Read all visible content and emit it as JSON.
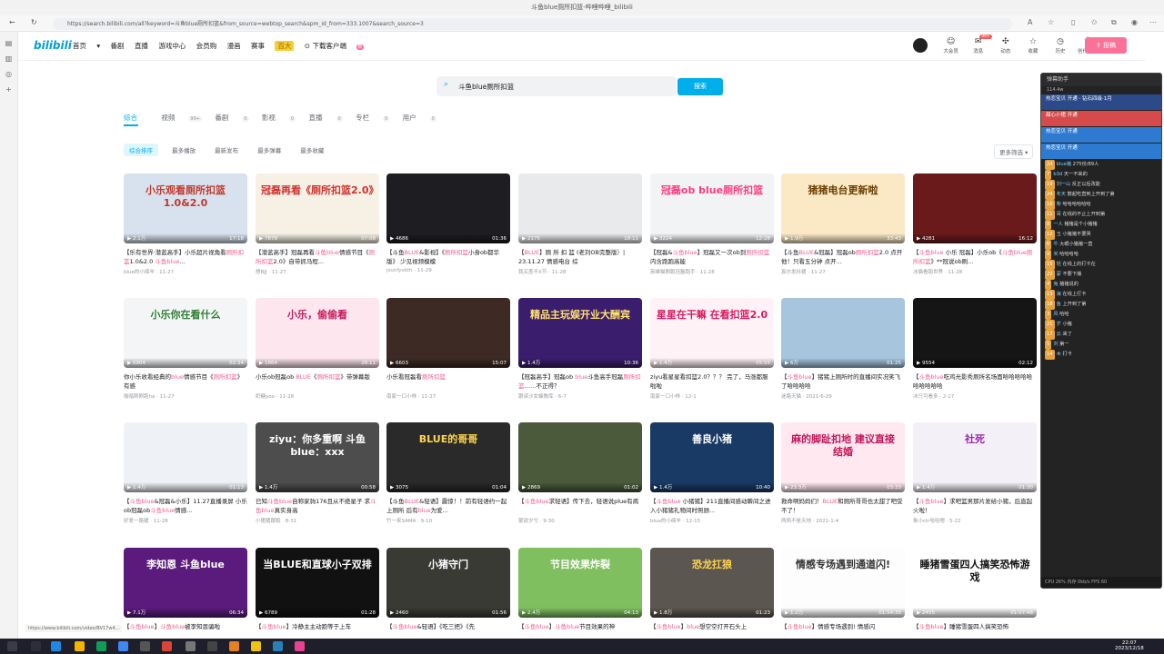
{
  "window": {
    "title": "斗鱼blue厕所扣篮-哔哩哔哩_bilibili"
  },
  "address": {
    "url": "https://search.bilibili.com/all?keyword=斗鱼blue厕所扣篮&from_source=webtop_search&spm_id_from=333.1007&search_source=3"
  },
  "header": {
    "logo": "bilibili",
    "nav": [
      "首页",
      "番剧",
      "直播",
      "游戏中心",
      "会员购",
      "漫画",
      "赛事"
    ],
    "badge": "百大",
    "download": "下载客户端",
    "download_dot": "新",
    "right_items": [
      {
        "icon": "☺",
        "label": "大会员"
      },
      {
        "icon": "✉",
        "label": "消息",
        "badge": "99+"
      },
      {
        "icon": "✣",
        "label": "动态"
      },
      {
        "icon": "☆",
        "label": "收藏"
      },
      {
        "icon": "◷",
        "label": "历史"
      },
      {
        "icon": "♁",
        "label": "创作中心"
      }
    ],
    "upload": "投稿"
  },
  "search": {
    "query": "斗鱼blue厕所扣篮",
    "button": "搜索"
  },
  "tabs": [
    {
      "label": "综合",
      "count": ""
    },
    {
      "label": "视频",
      "count": "99+"
    },
    {
      "label": "番剧",
      "count": "0"
    },
    {
      "label": "影视",
      "count": "0"
    },
    {
      "label": "直播",
      "count": "0"
    },
    {
      "label": "专栏",
      "count": "0"
    },
    {
      "label": "用户",
      "count": "0"
    }
  ],
  "filters": [
    "综合排序",
    "最多播放",
    "最新发布",
    "最多弹幕",
    "最多收藏"
  ],
  "more_filter": "更多筛选",
  "videos": [
    {
      "cap": "小乐观看厕所扣篮1.0&2.0",
      "views": "2.1万",
      "dur": "17:18",
      "title": "【乐有世界·潜蓝高手】小乐超片视角看厕所扣篮1.0&2.0 斗鱼blue...",
      "up": "blue的小绵羊 · 11-27",
      "bg": "#d8e2ee",
      "fg": "#c0392b"
    },
    {
      "cap": "冠磊再看《厕所扣篮2.0》",
      "views": "7878",
      "dur": "07:08",
      "title": "【潜蓝高手】冠磊再看斗鱼blue情感节目《厕所扣篮2.0》自带抓马程...",
      "up": "想BJJ · 11-27",
      "bg": "#f6f1e4",
      "fg": "#d32f2f"
    },
    {
      "cap": "",
      "views": "4686",
      "dur": "01:36",
      "title": "【斗鱼BLUE&影视】《厕所扣篮小身ob都华版》 少见视频模模",
      "up": "jsunfyvkth · 11-29",
      "bg": "#1e1e22",
      "fg": "#fff"
    },
    {
      "cap": "",
      "views": "2175",
      "dur": "18:11",
      "title": "【BLUE】厕 所 扣 篮 (老刘OB完整版）| 23.11.27 情感电台 综",
      "up": "我买差不X节 · 11-28",
      "bg": "#e9eaec",
      "fg": "#333"
    },
    {
      "cap": "冠磊ob blue厕所扣篮",
      "views": "3224",
      "dur": "12:28",
      "title": "【冠磊&斗鱼blue】冠磊又一次ob到厕所扣篮 内含跑跑高能",
      "up": "英雄猫刚跑冠磊跑手 · 11-28",
      "bg": "#f2f3f5",
      "fg": "#ff3b7f"
    },
    {
      "cap": "猪猪电台更新啦",
      "views": "1.9万",
      "dur": "33:43",
      "title": "【斗鱼BLUE&冠磊】冠磊ob厕所扣篮2.0 点开他！只看五分钟 点开...",
      "up": "真尔发抖猪 · 11-27",
      "bg": "#fbe9c6",
      "fg": "#6b3e00"
    },
    {
      "cap": "",
      "views": "4281",
      "dur": "16:12",
      "title": "【斗鱼blue 小乐 冠磊】小乐ob《斗鱼blue厕所扣篮》**冠说ob刷...",
      "up": "冰猫看跑世界 · 11-28",
      "bg": "#6a1a1a",
      "fg": "#fff"
    },
    {
      "cap": "小乐你在看什么",
      "views": "6904",
      "dur": "02:34",
      "title": "你小乐收看经典的blue情感节目《厕所扣篮》有感",
      "up": "咖暗刚刚跑ha · 11-27",
      "bg": "#f4f5f7",
      "fg": "#2e7d32"
    },
    {
      "cap": "小乐，偷偷看",
      "views": "1864",
      "dur": "28:11",
      "title": "小乐ob冠磊ob BLUE《厕所扣篮》带弹幕版",
      "up": "奶糖yoo · 11-28",
      "bg": "#fde6ee",
      "fg": "#c2185b"
    },
    {
      "cap": "",
      "views": "6603",
      "dur": "15:07",
      "title": "小乐看冠磊看厕所扣篮",
      "up": "南家一口小林 · 11-27",
      "bg": "#3d2a24",
      "fg": "#fff"
    },
    {
      "cap": "精品主玩娱开业大酬宾",
      "views": "1.4万",
      "dur": "10:36",
      "title": "【冠磊高手】冠磊ob blue斗鱼高手冠磊厕所扣篮……不正得？",
      "up": "跟读沙女蜂教库 · 6-7",
      "bg": "#3b1d6e",
      "fg": "#ffe16b"
    },
    {
      "cap": "星星在干嘛 在看扣篮2.0",
      "views": "1.4万",
      "dur": "05:55",
      "title": "ziyu看星星看扣篮2.0？？？ 完了，马涨都服啦啦",
      "up": "南家一口小林 · 12-1",
      "bg": "#fff2f6",
      "fg": "#d81b60"
    },
    {
      "cap": "",
      "views": "6万",
      "dur": "01:25",
      "title": "【斗鱼blue】猪猪上厕所时的直播间实况笑飞了哈哈哈哈",
      "up": "迷路天猫 · 2021-6-29",
      "bg": "#a7c6de",
      "fg": "#fff"
    },
    {
      "cap": "",
      "views": "9554",
      "dur": "02:12",
      "title": "【斗鱼blue吃鸡光影秀厕所名场面哈哈哈哈哈哈哈哈哈哈",
      "up": "冰只可看多 · 2-17",
      "bg": "#151515",
      "fg": "#fff"
    },
    {
      "cap": "",
      "views": "1.4万",
      "dur": "01:13",
      "title": "【斗鱼blue&冠磊&小乐】11.27直播录屏 小乐ob冠磊ob斗鱼blue情感...",
      "up": "好爱一路猪 · 11-28",
      "bg": "#eef1f5",
      "fg": "#333"
    },
    {
      "cap": "ziyu：你多重啊 斗鱼blue：xxx",
      "views": "1.4万",
      "dur": "00:58",
      "title": "已知斗鱼blue自称家驹176且从不绝星子 求斗鱼blue真实身高",
      "up": "小猪猪跟跑 · 8-31",
      "bg": "#4d4d4d",
      "fg": "#fff"
    },
    {
      "cap": "BLUE的哥哥",
      "views": "3075",
      "dur": "01:04",
      "title": "【斗鱼BLUE&轻语】震惊！！前有轻语约一起上厕所 后有blue为爱...",
      "up": "竹一来SAMA · 9-10",
      "bg": "#2a2a2a",
      "fg": "#ffd54f"
    },
    {
      "cap": "",
      "views": "2869",
      "dur": "01:02",
      "title": "【斗鱼blue求轻语】传下去，轻语说plue有病",
      "up": "蒙锐夕兮 · 9-30",
      "bg": "#4a5a3a",
      "fg": "#ff5a5a"
    },
    {
      "cap": "善良小猪",
      "views": "1.4万",
      "dur": "10:40",
      "title": "【斗鱼blue 小猪猪】211直播间感动瞬间之进入小猪猪礼物间时照顾...",
      "up": "blue的小绵羊 · 12-15",
      "bg": "#1a3a66",
      "fg": "#fff"
    },
    {
      "cap": "麻的脚趾扣地 建议直接结婚",
      "views": "23.3万",
      "dur": "03:33",
      "title": "救命啊妈妈们！BLUE和厕所哥哥也太甜了吧受不了！",
      "up": "两两不是天地 · 2021-1-4",
      "bg": "#ffe8ef",
      "fg": "#c2185b"
    },
    {
      "cap": "社死",
      "views": "1.4万",
      "dur": "01:30",
      "title": "【斗鱼blue】求吧篮男那片发给小猪，后直起火啦！",
      "up": "象小ctr哈哈嗯 · 5-22",
      "bg": "#f3f0f7",
      "fg": "#9c27b0"
    },
    {
      "cap": "李知恩 斗鱼blue",
      "views": "7.1万",
      "dur": "06:34",
      "title": "【斗鱼blue】斗鱼blue被李知恩骗啦",
      "up": "",
      "bg": "#5a1b7d",
      "fg": "#fff"
    },
    {
      "cap": "当BLUE和直球小子双排",
      "views": "6789",
      "dur": "01:28",
      "title": "【斗鱼blue】冷静主主动跑等于上车",
      "up": "",
      "bg": "#111",
      "fg": "#fff"
    },
    {
      "cap": "小猪守门",
      "views": "2460",
      "dur": "01:56",
      "title": "【斗鱼blue&轻语】《吃三把》《先",
      "up": "",
      "bg": "#3a3a34",
      "fg": "#fff"
    },
    {
      "cap": "节目效果炸裂",
      "views": "2.4万",
      "dur": "04:13",
      "title": "【斗鱼blue】斗鱼blue节目效果的神",
      "up": "",
      "bg": "#7fbf5f",
      "fg": "#fff"
    },
    {
      "cap": "恐龙扛狼",
      "views": "1.8万",
      "dur": "01:23",
      "title": "【斗鱼blue】blue想空空打开石头上",
      "up": "",
      "bg": "#5b5650",
      "fg": "#ffd54f"
    },
    {
      "cap": "情感专场遇到通道闪!",
      "views": "1.2万",
      "dur": "01:54:35",
      "title": "【斗鱼blue】情感专场遇到! 情感闪",
      "up": "",
      "bg": "#fdfdfd",
      "fg": "#333"
    },
    {
      "cap": "睡猪雪蛋四人搞笑恐怖游戏",
      "views": "2455",
      "dur": "01:07:48",
      "title": "【斗鱼blue】睡猪雪蛋四人搞笑恐怖",
      "up": "",
      "bg": "#ffffff",
      "fg": "#111"
    }
  ],
  "danmaku_panel": {
    "title": "弹幕助手",
    "stats": "114.4w",
    "banners": [
      {
        "text": "热恋宝贝 开通 · 钻石四级·1月",
        "color": "#2c4a8a"
      },
      {
        "text": "甜心小猪 开通",
        "color": "#d54a4a"
      },
      {
        "text": "热恋宝贝 开通",
        "color": "#2f7ad1"
      },
      {
        "text": "热恋宝贝 开通",
        "color": "#2f7ad1"
      }
    ],
    "messages": [
      {
        "lv": "24",
        "name": "blue猪",
        "text": "275份/89人"
      },
      {
        "lv": "7",
        "name": "b3d",
        "text": "天一不来的"
      },
      {
        "lv": "19",
        "name": "刘一山",
        "text": "反正以后改能"
      },
      {
        "lv": "24",
        "name": "冬天",
        "text": "鼓起吃直到上开到了第"
      },
      {
        "lv": "10",
        "name": "柴",
        "text": "哈哈哈哈哈哈"
      },
      {
        "lv": "11",
        "name": "哥",
        "text": "在线的不止上开到第"
      },
      {
        "lv": "8",
        "name": "一人",
        "text": "猪猪是个小猪猪"
      },
      {
        "lv": "12",
        "name": "玉",
        "text": "小猪猪不要哭"
      },
      {
        "lv": "6",
        "name": "牛",
        "text": "大眼小猪猪一直"
      },
      {
        "lv": "9",
        "name": "米",
        "text": "哈哈哈哈"
      },
      {
        "lv": "15",
        "name": "轻",
        "text": "在线上的打卡在"
      },
      {
        "lv": "22",
        "name": "蒙",
        "text": "不要下播"
      },
      {
        "lv": "4",
        "name": "兔",
        "text": "猪猪说的"
      },
      {
        "lv": "13",
        "name": "海",
        "text": "在线上打卡"
      },
      {
        "lv": "18",
        "name": "鱼",
        "text": "上开到了第"
      },
      {
        "lv": "3",
        "name": "风",
        "text": "哈哈"
      },
      {
        "lv": "21",
        "name": "岁",
        "text": "小猪"
      },
      {
        "lv": "17",
        "name": "云",
        "text": "来了"
      },
      {
        "lv": "5",
        "name": "刘",
        "text": "第一"
      },
      {
        "lv": "14",
        "name": "木",
        "text": "打卡"
      }
    ],
    "footer": "CPU 26% 内存 0kb/s FPS 60"
  },
  "status_url": "https://www.bilibili.com/video/BV17w4...",
  "clock": {
    "time": "22:07",
    "date": "2023/12/18"
  }
}
